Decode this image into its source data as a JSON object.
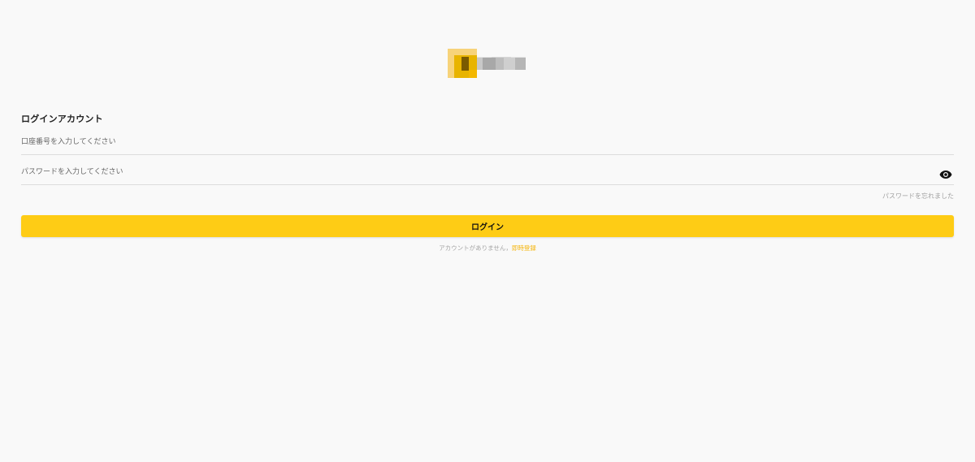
{
  "logo": {
    "name": "logo"
  },
  "login": {
    "heading": "ログインアカウント",
    "account_placeholder": "口座番号を入力してください",
    "password_placeholder": "パスワードを入力してください",
    "forgot_link": "パスワードを忘れました",
    "login_button": "ログイン",
    "no_account_text": "アカウントがありません，",
    "signup_link": "即時登録"
  },
  "icons": {
    "password_toggle": "eye-icon"
  },
  "colors": {
    "background": "#f9f9f9",
    "accent": "#fecc15",
    "link": "#f5b50c"
  }
}
